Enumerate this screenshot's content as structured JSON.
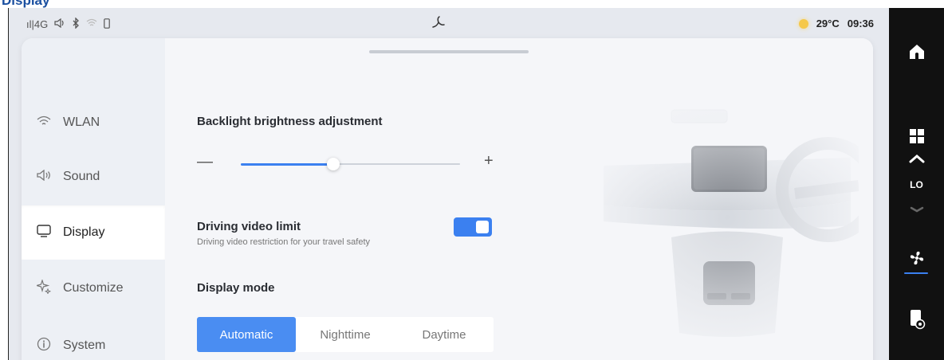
{
  "page_header": "Display",
  "status_bar": {
    "signal": " ıl|4G",
    "time": "09:36",
    "temperature": "29°C"
  },
  "sidebar": {
    "items": [
      {
        "label": "WLAN",
        "icon": "wifi-icon"
      },
      {
        "label": "Sound",
        "icon": "speaker-icon"
      },
      {
        "label": "Display",
        "icon": "monitor-icon",
        "active": true
      },
      {
        "label": "Customize",
        "icon": "sparkle-icon"
      },
      {
        "label": "System",
        "icon": "info-icon"
      }
    ]
  },
  "content": {
    "brightness": {
      "title": "Backlight brightness adjustment",
      "level": 0.42
    },
    "driving_video": {
      "title": "Driving video limit",
      "subtitle": "Driving video restriction for your travel safety",
      "enabled": true
    },
    "display_mode": {
      "title": "Display mode",
      "options": [
        "Automatic",
        "Nighttime",
        "Daytime"
      ],
      "selected": "Automatic"
    }
  },
  "right_bar": {
    "ac_level": "LO"
  },
  "colors": {
    "accent": "#3b80f0",
    "segment_active": "#4a8df2",
    "right_bar_bg": "#111111"
  }
}
